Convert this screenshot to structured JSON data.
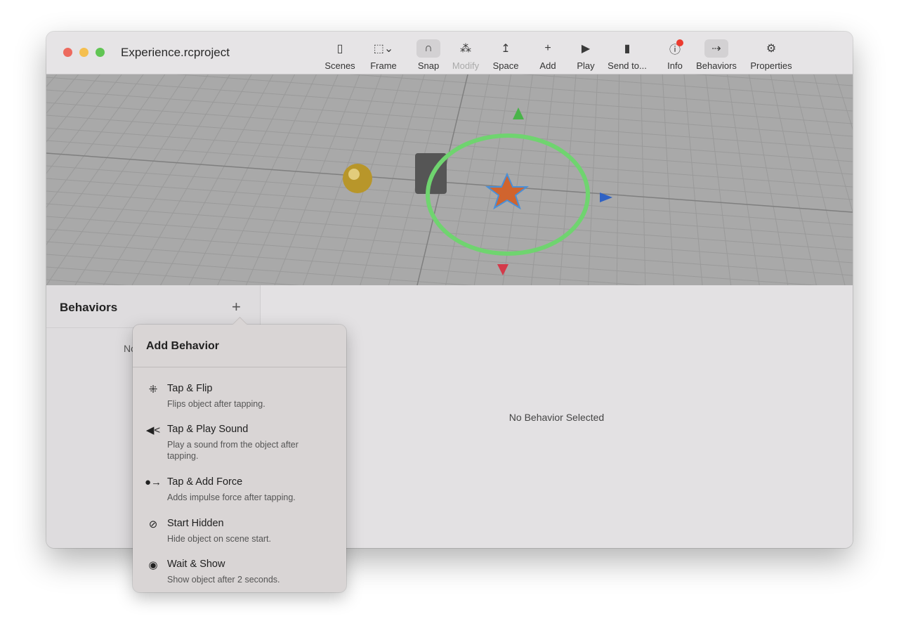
{
  "window": {
    "title": "Experience.rcproject"
  },
  "toolbar": [
    {
      "label": "Scenes",
      "icon": "sidebar-icon",
      "glyph": "▯"
    },
    {
      "label": "Frame",
      "icon": "frame-icon",
      "glyph": "⬚⌄"
    },
    {
      "label": "Snap",
      "icon": "magnet-icon",
      "glyph": "∩",
      "selected": true
    },
    {
      "label": "Modify",
      "icon": "modify-icon",
      "glyph": "⁂",
      "disabled": true
    },
    {
      "label": "Space",
      "icon": "space-icon",
      "glyph": "↥"
    },
    {
      "label": "Add",
      "icon": "plus-icon",
      "glyph": "+"
    },
    {
      "label": "Play",
      "icon": "play-icon",
      "glyph": "▶"
    },
    {
      "label": "Send to...",
      "icon": "send-icon",
      "glyph": "▮"
    },
    {
      "label": "Info",
      "icon": "info-icon",
      "glyph": "ⓘ",
      "badge": true
    },
    {
      "label": "Behaviors",
      "icon": "behaviors-icon",
      "glyph": "⇢",
      "selected": true
    },
    {
      "label": "Properties",
      "icon": "gear-icon",
      "glyph": "⚙"
    }
  ],
  "behaviors_panel": {
    "title": "Behaviors",
    "empty": "No Behaviors"
  },
  "detail": {
    "empty": "No Behavior Selected"
  },
  "popover": {
    "title": "Add Behavior",
    "items": [
      {
        "name": "Tap & Flip",
        "desc": "Flips object after tapping.",
        "glyph": "⁜"
      },
      {
        "name": "Tap & Play Sound",
        "desc": "Play a sound from the object after tapping.",
        "glyph": "◀<"
      },
      {
        "name": "Tap & Add Force",
        "desc": "Adds impulse force after tapping.",
        "glyph": "●→"
      },
      {
        "name": "Start Hidden",
        "desc": "Hide object on scene start.",
        "glyph": "⊘"
      },
      {
        "name": "Wait & Show",
        "desc": "Show object after 2 seconds.",
        "glyph": "◉"
      }
    ]
  },
  "colors": {
    "close": "#ed6a5e",
    "min": "#f5bf4f",
    "max": "#61c554",
    "ring": "#6fd46f",
    "star": "#d0642e"
  }
}
